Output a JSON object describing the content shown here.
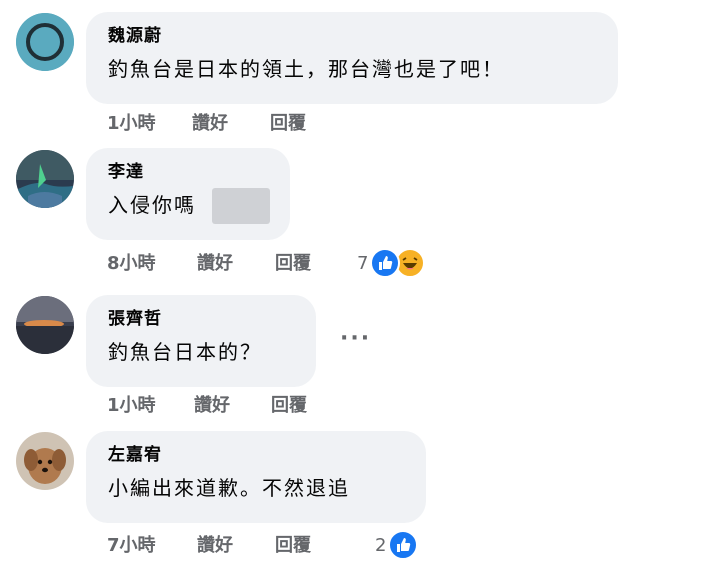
{
  "comments": [
    {
      "author": "魏源蔚",
      "text": "釣魚台是日本的領土，那台灣也是了吧！",
      "time": "1小時",
      "like_label": "讚好",
      "reply_label": "回覆",
      "avatar_icon": "ring-avatar-icon"
    },
    {
      "author": "李達",
      "text": "入侵你嗎",
      "time": "8小時",
      "like_label": "讚好",
      "reply_label": "回覆",
      "reaction_count": "7",
      "reactions": [
        "like-icon",
        "haha-icon"
      ]
    },
    {
      "author": "張齊哲",
      "text": "釣魚台日本的？",
      "time": "1小時",
      "like_label": "讚好",
      "reply_label": "回覆",
      "more_label": "···"
    },
    {
      "author": "左嘉宥",
      "text": "小編出來道歉。不然退追",
      "time": "7小時",
      "like_label": "讚好",
      "reply_label": "回覆",
      "reaction_count": "2",
      "reactions": [
        "like-icon"
      ]
    }
  ],
  "colors": {
    "bubble": "#f0f2f5",
    "like_blue": "#1877f2",
    "meta_gray": "#65676b",
    "haha_yellow": "#f7b125"
  }
}
